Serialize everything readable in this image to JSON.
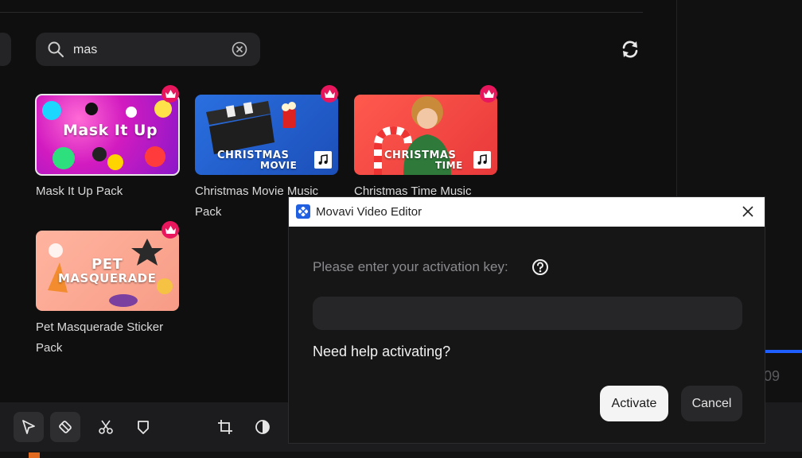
{
  "search": {
    "value": "mas",
    "icon": "search-icon",
    "clear_icon": "clear-icon"
  },
  "refresh_icon": "refresh-icon",
  "packs": [
    {
      "name": "Mask It Up Pack",
      "thumb_text": "Mask It Up",
      "premium": true,
      "selected": true
    },
    {
      "name": "Christmas Movie Music Pack",
      "thumb_text_1": "CHRISTMAS",
      "thumb_text_2": "MOVIE",
      "premium": true,
      "music": true
    },
    {
      "name": "Christmas Time Music",
      "thumb_text_1": "CHRISTMAS",
      "thumb_text_2": "TIME",
      "premium": true,
      "music": true
    },
    {
      "name": "Pet Masquerade Sticker Pack",
      "thumb_text_1": "PET",
      "thumb_text_2": "MASQUERADE",
      "premium": true
    }
  ],
  "dialog": {
    "title": "Movavi Video Editor",
    "prompt": "Please enter your activation key:",
    "key_value": "",
    "help_link": "Need help activating?",
    "activate_label": "Activate",
    "cancel_label": "Cancel"
  },
  "background_fragment": "09",
  "toolbar": [
    "select-icon",
    "eraser-icon",
    "scissors-icon",
    "shield-icon",
    "crop-icon",
    "color-icon"
  ],
  "colors": {
    "accent": "#1f5fff",
    "premium": "#e8175d",
    "dialog_bg": "#161617"
  }
}
